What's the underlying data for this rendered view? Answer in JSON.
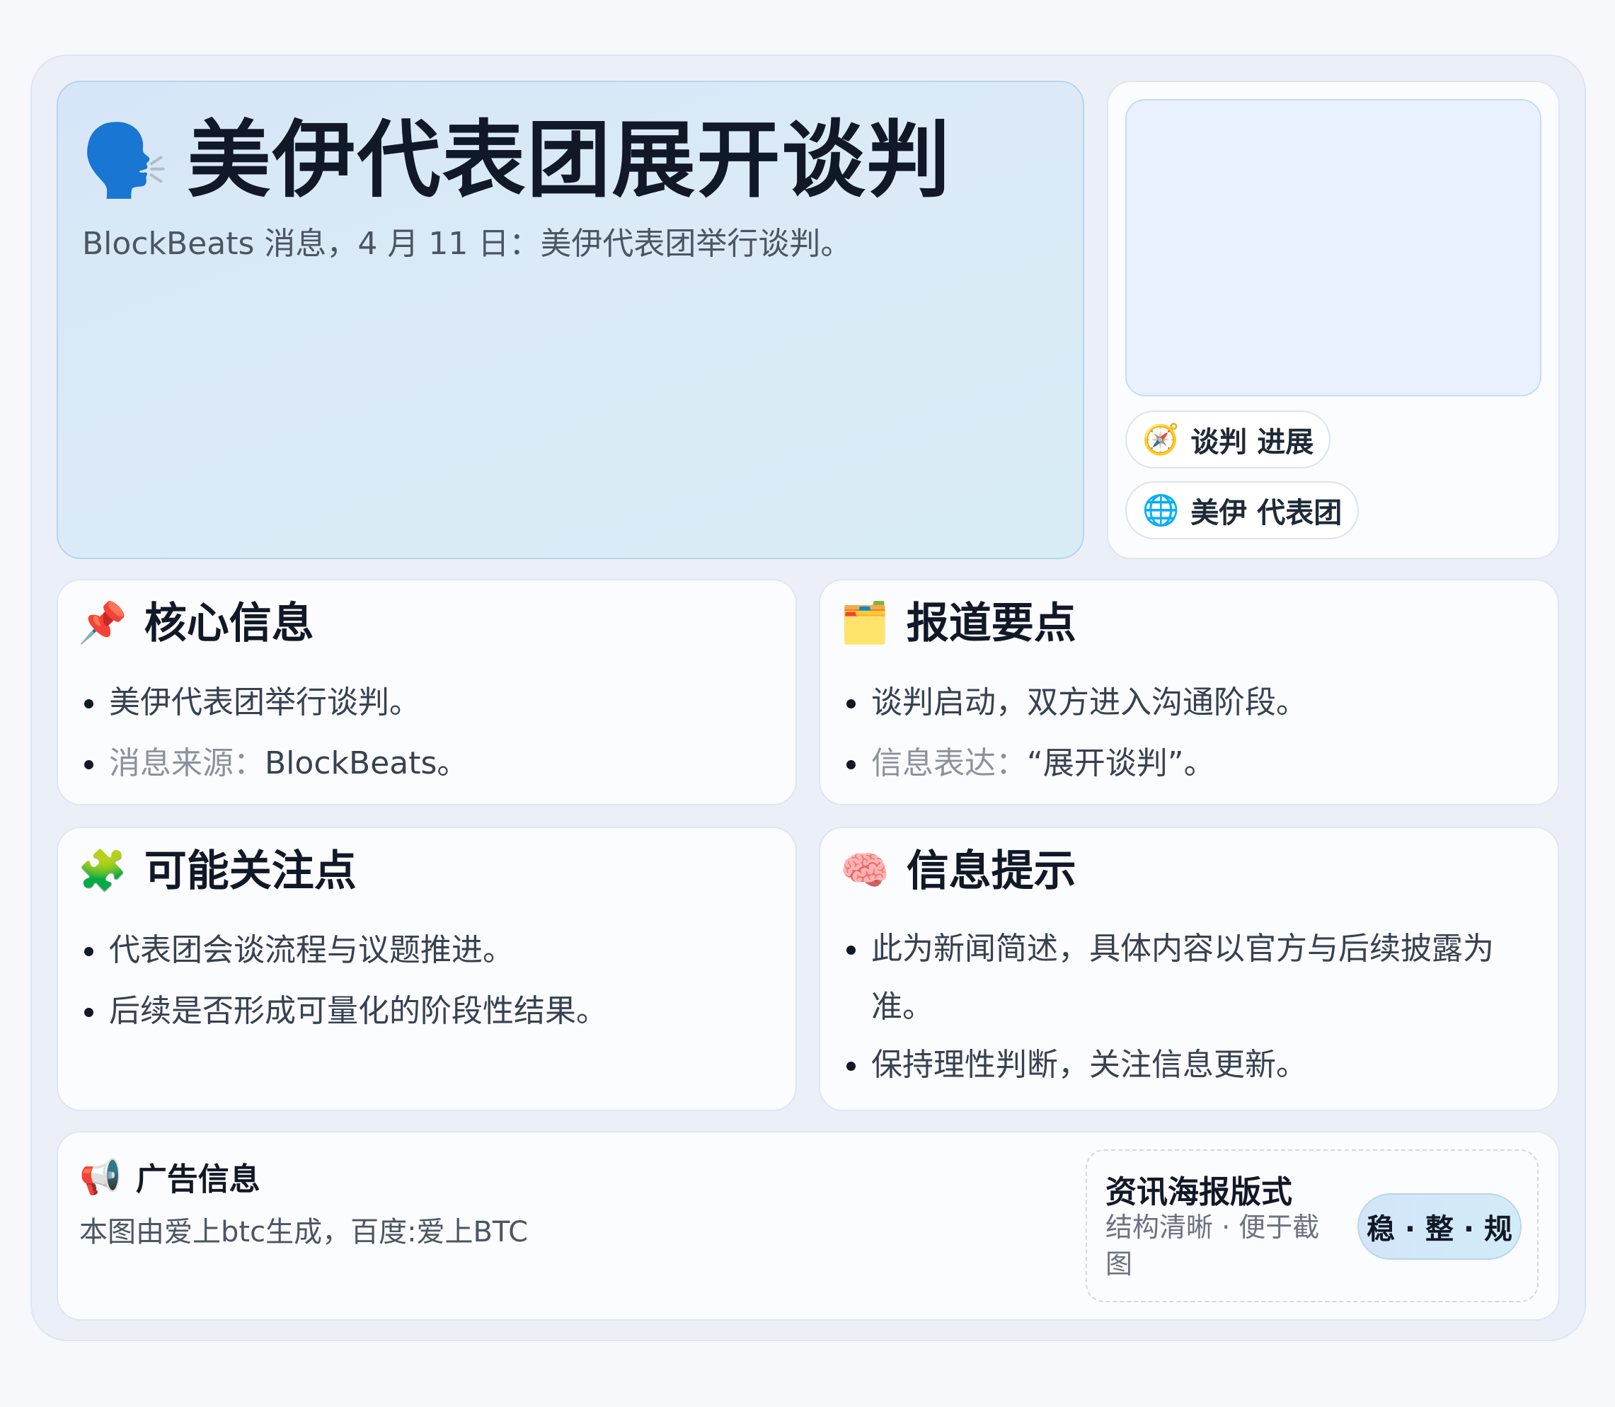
{
  "hero": {
    "icon": "speaking-head-icon",
    "icon_glyph": "🗣️",
    "title": "美伊代表团展开谈判",
    "subtitle": "BlockBeats 消息，4 月 11 日：美伊代表团举行谈判。"
  },
  "side": {
    "tags": [
      {
        "icon": "compass-icon",
        "glyph": "🧭",
        "label": "谈判 进展"
      },
      {
        "icon": "globe-icon",
        "glyph": "🌐",
        "label": "美伊 代表团"
      }
    ]
  },
  "cards": {
    "core": {
      "icon": "pushpin-icon",
      "glyph": "📌",
      "title": "核心信息",
      "items": [
        {
          "text": "美伊代表团举行谈判。"
        },
        {
          "label": "消息来源：",
          "text": "BlockBeats。"
        }
      ]
    },
    "report": {
      "icon": "card-index-dividers-icon",
      "glyph": "🗂️",
      "title": "报道要点",
      "items": [
        {
          "text": "谈判启动，双方进入沟通阶段。"
        },
        {
          "label": "信息表达：",
          "text": "“展开谈判”。"
        }
      ]
    },
    "focus": {
      "icon": "puzzle-piece-icon",
      "glyph": "🧩",
      "title": "可能关注点",
      "items": [
        {
          "text": "代表团会谈流程与议题推进。"
        },
        {
          "text": "后续是否形成可量化的阶段性结果。"
        }
      ]
    },
    "hint": {
      "icon": "brain-icon",
      "glyph": "🧠",
      "title": "信息提示",
      "items": [
        {
          "text": "此为新闻简述，具体内容以官方与后续披露为准。"
        },
        {
          "text": "保持理性判断，关注信息更新。"
        }
      ]
    }
  },
  "ad": {
    "icon": "megaphone-icon",
    "glyph": "📢",
    "title": "广告信息",
    "text": "本图由爱上btc生成，百度:爱上BTC",
    "badge_title": "资讯海报版式",
    "badge_subtitle": "结构清晰 · 便于截图",
    "pill": "稳 · 整 · 规"
  },
  "colors": {
    "accent_border": "#b9d3ef",
    "text_primary": "#111827",
    "text_muted": "#8a929e"
  }
}
